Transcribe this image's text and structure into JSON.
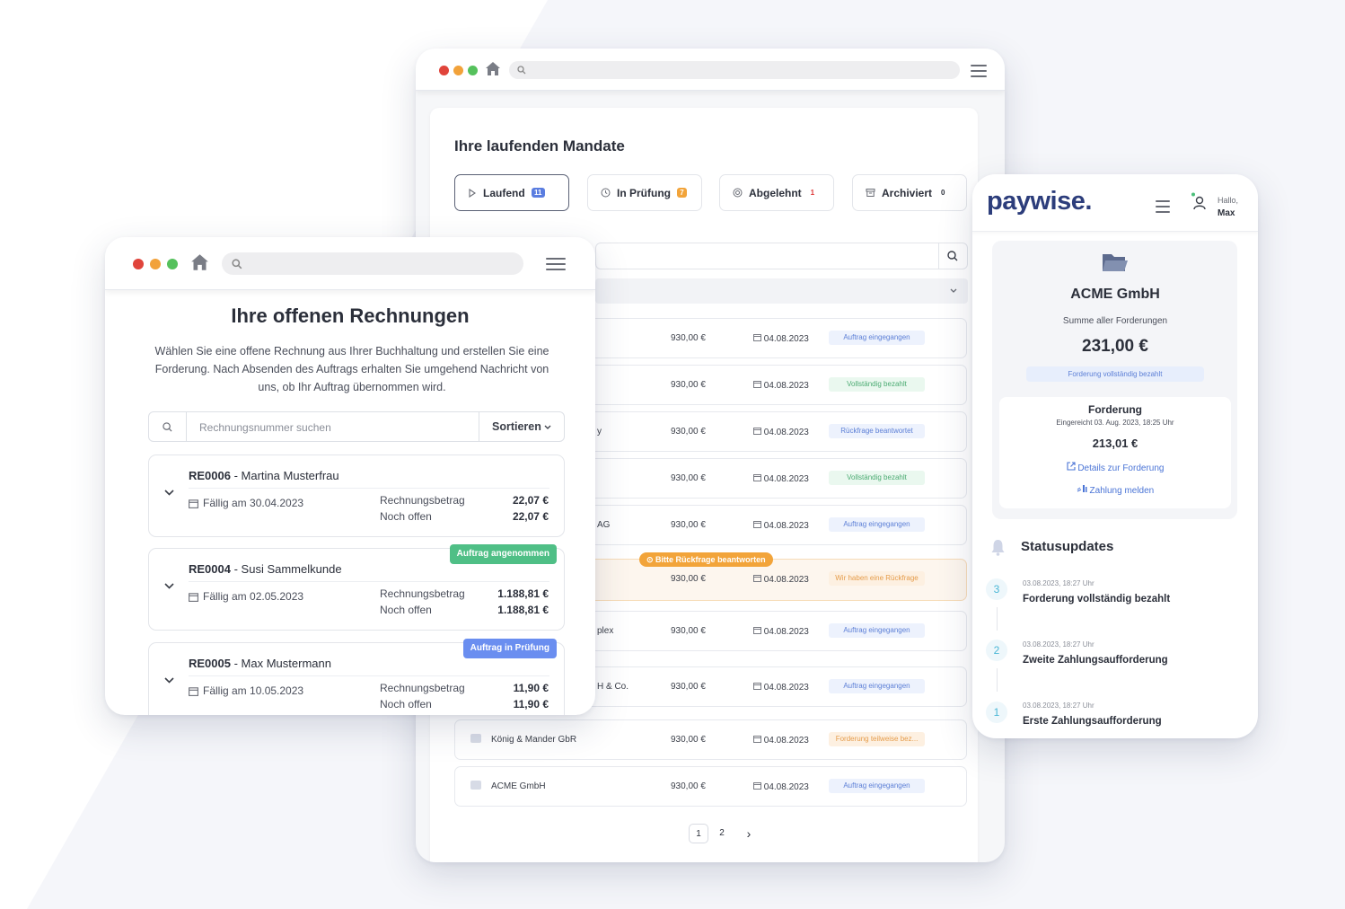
{
  "center": {
    "title": "Ihre laufenden Mandate",
    "tabs": [
      {
        "label": "Laufend",
        "count": "11",
        "badge_color": "#5a7de0"
      },
      {
        "label": "In Prüfung",
        "count": "7",
        "badge_color": "#f2a43a"
      },
      {
        "label": "Abgelehnt",
        "count": "1",
        "badge_color": "#d33b3b"
      },
      {
        "label": "Archiviert",
        "count": "0",
        "badge_color": "#2b2f3a"
      }
    ],
    "warning_pill": "Bitte Rückfrage beantworten",
    "rows": [
      {
        "name": "",
        "amount": "930,00 €",
        "date": "04.08.2023",
        "status": "Auftrag eingegangen",
        "status_color": "blue"
      },
      {
        "name": "",
        "amount": "930,00 €",
        "date": "04.08.2023",
        "status": "Vollständig bezahlt",
        "status_color": "green"
      },
      {
        "name": "y",
        "amount": "930,00 €",
        "date": "04.08.2023",
        "status": "Rückfrage beantwortet",
        "status_color": "blue"
      },
      {
        "name": "",
        "amount": "930,00 €",
        "date": "04.08.2023",
        "status": "Vollständig bezahlt",
        "status_color": "green"
      },
      {
        "name": "AG",
        "amount": "930,00 €",
        "date": "04.08.2023",
        "status": "Auftrag eingegangen",
        "status_color": "blue"
      },
      {
        "name": "",
        "amount": "930,00 €",
        "date": "04.08.2023",
        "status": "Wir haben eine Rückfrage",
        "status_color": "orange"
      },
      {
        "name": "plex",
        "amount": "930,00 €",
        "date": "04.08.2023",
        "status": "Auftrag eingegangen",
        "status_color": "blue"
      },
      {
        "name": "H & Co.",
        "amount": "930,00 €",
        "date": "04.08.2023",
        "status": "Auftrag eingegangen",
        "status_color": "blue"
      },
      {
        "name": "König & Mander GbR",
        "amount": "930,00 €",
        "date": "04.08.2023",
        "status": "Forderung teilweise bez...",
        "status_color": "orange"
      },
      {
        "name": "ACME GmbH",
        "amount": "930,00 €",
        "date": "04.08.2023",
        "status": "Auftrag eingegangen",
        "status_color": "blue"
      }
    ],
    "pagination": {
      "pages": [
        "1",
        "2"
      ],
      "current": "1",
      "next": "›"
    }
  },
  "left": {
    "title": "Ihre offenen Rechnungen",
    "description": "Wählen Sie eine offene Rechnung aus Ihrer Buchhaltung und erstellen Sie eine Forderung. Nach Absenden des Auftrags erhalten Sie umgehend Nachricht von uns, ob Ihr Auftrag übernommen wird.",
    "search_placeholder": "Rechnungsnummer suchen",
    "sort_label": "Sortieren",
    "amount_label": "Rechnungsbetrag",
    "open_label": "Noch offen",
    "invoices": [
      {
        "id": "RE0006",
        "customer": "Martina Musterfrau",
        "due": "Fällig am 30.04.2023",
        "amount": "22,07 €",
        "open": "22,07 €",
        "tag": "",
        "tag_color": ""
      },
      {
        "id": "RE0004",
        "customer": "Susi Sammelkunde",
        "due": "Fällig am 02.05.2023",
        "amount": "1.188,81 €",
        "open": "1.188,81 €",
        "tag": "Auftrag angenommen",
        "tag_color": "#4fbf86"
      },
      {
        "id": "RE0005",
        "customer": "Max Mustermann",
        "due": "Fällig am 10.05.2023",
        "amount": "11,90 €",
        "open": "11,90 €",
        "tag": "Auftrag in Prüfung",
        "tag_color": "#6a8ef0"
      }
    ]
  },
  "right": {
    "logo": "paywise.",
    "greeting": "Hallo,",
    "user": "Max",
    "company": "ACME GmbH",
    "sum_label": "Summe aller Forderungen",
    "sum_value": "231,00 €",
    "sum_status": "Forderung vollständig bezahlt",
    "claim_title": "Forderung",
    "claim_submitted": "Eingereicht 03. Aug. 2023, 18:25 Uhr",
    "claim_value": "213,01 €",
    "details_link": "Details zur Forderung",
    "payment_link": "Zahlung melden",
    "updates_title": "Statusupdates",
    "updates": [
      {
        "step": "3",
        "date": "03.08.2023, 18:27 Uhr",
        "title": "Forderung vollständig bezahlt"
      },
      {
        "step": "2",
        "date": "03.08.2023, 18:27 Uhr",
        "title": "Zweite Zahlungsaufforderung"
      },
      {
        "step": "1",
        "date": "03.08.2023, 18:27 Uhr",
        "title": "Erste Zahlungsaufforderung"
      }
    ]
  },
  "colors": {
    "accent": "#2c3d7b",
    "link": "#4a74d6",
    "background_shape": "#f4f5fa"
  }
}
